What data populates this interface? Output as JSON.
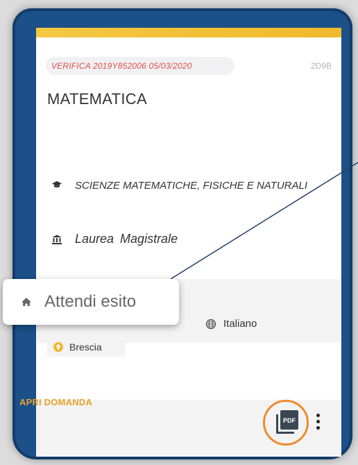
{
  "card": {
    "reference": "VERIFICA 2019Y852006 05/03/2020",
    "code": "2D9B",
    "title": "MATEMATICA",
    "faculty": "SCIENZE MATEMATICHE, FISICHE E NATURALI",
    "degree": "Laurea Magistrale",
    "language": "Italiano",
    "city": "Brescia",
    "status": "Attendi esito",
    "open_button": "APRI DOMANDA",
    "pdf_label": "PDF"
  },
  "colors": {
    "frame": "#1b5089",
    "accent_bar": "#f5c842",
    "reference_text": "#e24b4b",
    "open_button": "#e6a32b",
    "highlight_ring": "#ef8b2c"
  },
  "icons": {
    "faculty": "graduation-cap-icon",
    "degree": "university-icon",
    "status": "home-icon",
    "language": "globe-icon",
    "city": "location-pin-icon",
    "pdf": "pdf-file-icon",
    "menu": "more-vertical-icon"
  }
}
